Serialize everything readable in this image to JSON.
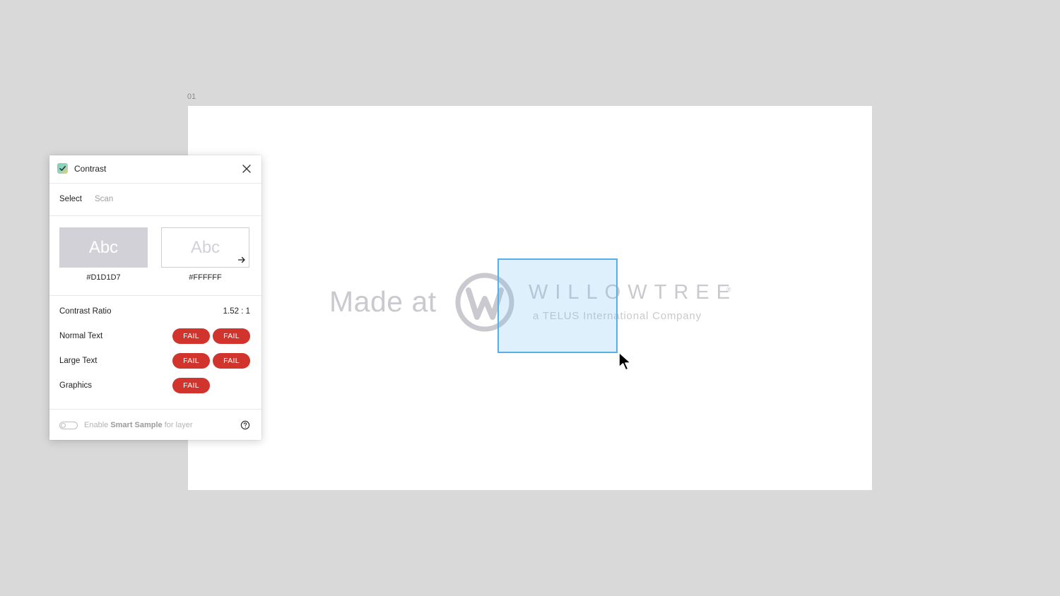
{
  "canvas": {
    "frame_label": "01",
    "artwork": {
      "made_at": "Made at",
      "brand_name": "WILLOWTREE",
      "brand_reg": "®",
      "brand_sub": "a TELUS International Company",
      "artwork_color": "#C9C9CF"
    },
    "selection_color": "#57AEE8"
  },
  "panel": {
    "title": "Contrast",
    "icons": {
      "plugin": "contrast-plugin-icon",
      "close": "close-icon",
      "swap": "arrow-right-icon",
      "help": "help-icon"
    },
    "tabs": [
      {
        "label": "Select",
        "active": true
      },
      {
        "label": "Scan",
        "active": false
      }
    ],
    "swatches": {
      "sample_text": "Abc",
      "foreground_hex": "#D1D1D7",
      "background_hex": "#FFFFFF"
    },
    "results": {
      "ratio_label": "Contrast Ratio",
      "ratio_value": "1.52 : 1",
      "rows": [
        {
          "label": "Normal Text",
          "badges": [
            "FAIL",
            "FAIL"
          ]
        },
        {
          "label": "Large Text",
          "badges": [
            "FAIL",
            "FAIL"
          ]
        },
        {
          "label": "Graphics",
          "badges": [
            "FAIL"
          ]
        }
      ],
      "fail_color": "#D0342C"
    },
    "footer": {
      "prefix": "Enable ",
      "emphasis": "Smart Sample",
      "suffix": " for layer",
      "toggle_on": false
    }
  }
}
